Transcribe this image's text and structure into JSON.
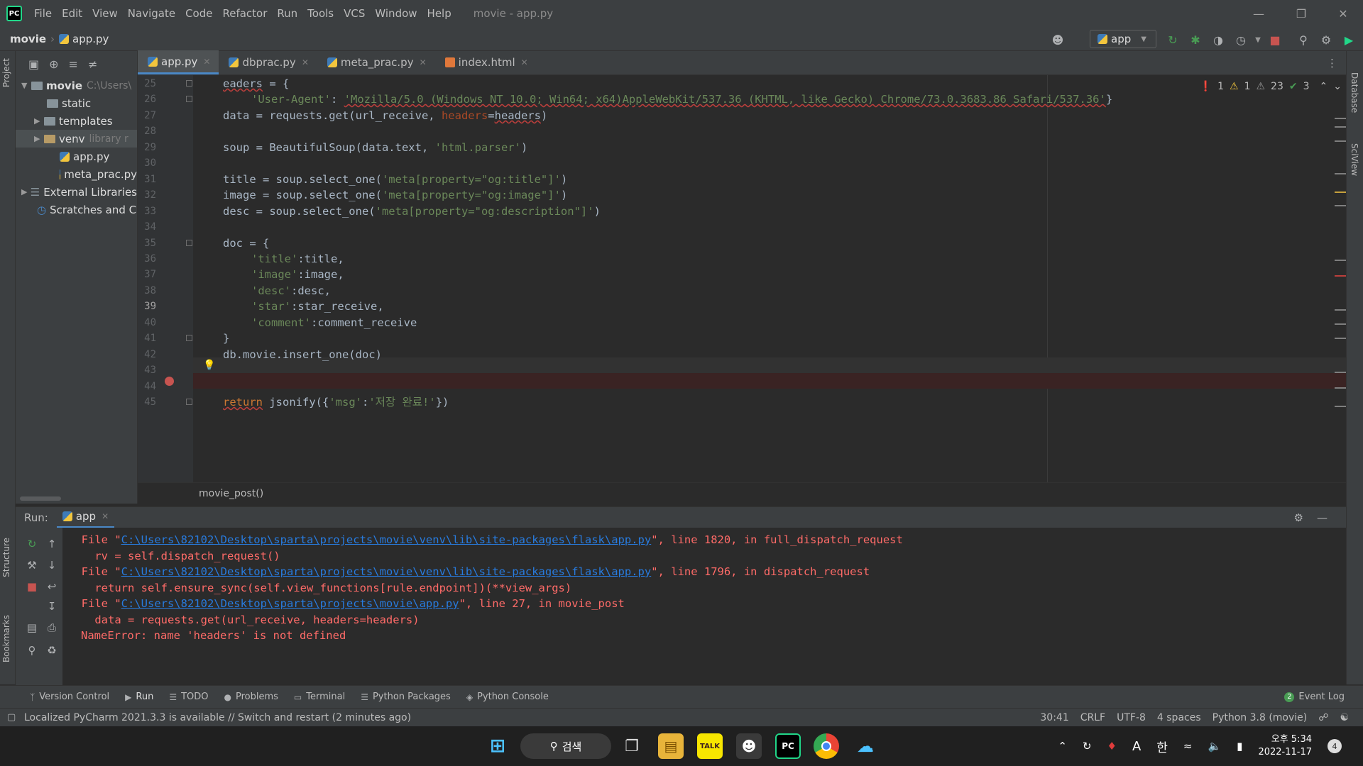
{
  "window": {
    "title": "movie - app.py",
    "menu": [
      "File",
      "Edit",
      "View",
      "Navigate",
      "Code",
      "Refactor",
      "Run",
      "Tools",
      "VCS",
      "Window",
      "Help"
    ],
    "logo_text": "PC"
  },
  "navbar": {
    "project": "movie",
    "file": "app.py",
    "run_config": "app"
  },
  "left_stripe": {
    "project_tab": "Project",
    "structure_tab": "Structure",
    "bookmarks_tab": "Bookmarks"
  },
  "right_stripe": {
    "database_tab": "Database",
    "sciview_tab": "SciView"
  },
  "project_tree": [
    {
      "label": "movie",
      "muted": "C:\\Users\\",
      "indent": 0,
      "type": "folder",
      "expanded": true
    },
    {
      "label": "static",
      "muted": "",
      "indent": 2,
      "type": "folder",
      "expanded": false
    },
    {
      "label": "templates",
      "muted": "",
      "indent": 1,
      "type": "folder",
      "expanded": false
    },
    {
      "label": "venv",
      "muted": "library r",
      "indent": 1,
      "type": "folder",
      "expanded": false
    },
    {
      "label": "app.py",
      "muted": "",
      "indent": 2,
      "type": "py"
    },
    {
      "label": "meta_prac.py",
      "muted": "",
      "indent": 2,
      "type": "py"
    },
    {
      "label": "External Libraries",
      "muted": "",
      "indent": 0,
      "type": "lib"
    },
    {
      "label": "Scratches and Co",
      "muted": "",
      "indent": 0,
      "type": "scratch"
    }
  ],
  "editor_tabs": [
    {
      "label": "app.py",
      "active": true,
      "icon": "py"
    },
    {
      "label": "dbprac.py",
      "active": false,
      "icon": "py"
    },
    {
      "label": "meta_prac.py",
      "active": false,
      "icon": "py"
    },
    {
      "label": "index.html",
      "active": false,
      "icon": "html"
    }
  ],
  "inspections": {
    "errors": "1",
    "warnings": "1",
    "weak_warnings": "23",
    "typos": "3"
  },
  "code": {
    "line_numbers": [
      "25",
      "26",
      "27",
      "28",
      "29",
      "30",
      "31",
      "32",
      "33",
      "34",
      "35",
      "36",
      "37",
      "38",
      "39",
      "40",
      "41",
      "42",
      "43",
      "44",
      "45"
    ],
    "current_line": "39",
    "breakpoint_line": "40",
    "l25_a": "eaders",
    "l25_b": " = {",
    "l26_key": "'User-Agent'",
    "l26_colon": ": ",
    "l26_val": "'Mozilla/5.0 (Windows NT 10.0; Win64; x64)AppleWebKit/537.36 (KHTML, like Gecko) Chrome/73.0.3683.86 Safari/537.36'",
    "l26_end": "}",
    "l27_a": "data = requests.get(url_receive, ",
    "l27_param": "headers",
    "l27_eq": "=",
    "l27_b": "headers",
    "l27_c": ")",
    "l29_a": "soup = BeautifulSoup(data.text, ",
    "l29_str": "'html.parser'",
    "l29_c": ")",
    "l31_a": "title = soup.select_one(",
    "l31_str": "'meta[property=\"og:title\"]'",
    "l31_c": ")",
    "l32_a": "image = soup.select_one(",
    "l32_str": "'meta[property=\"og:image\"]'",
    "l32_c": ")",
    "l33_a": "desc = soup.select_one(",
    "l33_str": "'meta[property=\"og:description\"]'",
    "l33_c": ")",
    "l35": "doc = {",
    "l36_str": "'title'",
    "l36_b": ":title,",
    "l37_str": "'image'",
    "l37_b": ":image,",
    "l38_str": "'desc'",
    "l38_b": ":desc,",
    "l39_str": "'star'",
    "l39_b": ":star_receive,",
    "l40_str": "'comment'",
    "l40_b": ":comment_receive",
    "l41": "}",
    "l42": "db.movie.insert_one(doc)",
    "l45_kw": "return",
    "l45_a": " jsonify({",
    "l45_str1": "'msg'",
    "l45_colon": ":",
    "l45_str2": "'저장 완료!'",
    "l45_c": "})"
  },
  "function_breadcrumb": "movie_post()",
  "run_panel": {
    "label": "Run:",
    "tab": "app",
    "lines": [
      {
        "pre": "  File \"",
        "link": "C:\\Users\\82102\\Desktop\\sparta\\projects\\movie\\venv\\lib\\site-packages\\flask\\app.py",
        "post": "\", line 1820, in full_dispatch_request"
      },
      {
        "pre": "    rv = self.dispatch_request()",
        "link": "",
        "post": ""
      },
      {
        "pre": "  File \"",
        "link": "C:\\Users\\82102\\Desktop\\sparta\\projects\\movie\\venv\\lib\\site-packages\\flask\\app.py",
        "post": "\", line 1796, in dispatch_request"
      },
      {
        "pre": "    return self.ensure_sync(self.view_functions[rule.endpoint])(**view_args)",
        "link": "",
        "post": ""
      },
      {
        "pre": "  File \"",
        "link": "C:\\Users\\82102\\Desktop\\sparta\\projects\\movie\\app.py",
        "post": "\", line 27, in movie_post"
      },
      {
        "pre": "    data = requests.get(url_receive, headers=headers)",
        "link": "",
        "post": ""
      },
      {
        "pre": "NameError: name 'headers' is not defined",
        "link": "",
        "post": ""
      }
    ]
  },
  "tool_tabs": [
    "Version Control",
    "Run",
    "TODO",
    "Problems",
    "Terminal",
    "Python Packages",
    "Python Console"
  ],
  "event_log": {
    "count": "2",
    "label": "Event Log"
  },
  "status": {
    "message": "Localized PyCharm 2021.3.3 is available // Switch and restart (2 minutes ago)",
    "position": "30:41",
    "line_sep": "CRLF",
    "encoding": "UTF-8",
    "indent": "4 spaces",
    "interpreter": "Python 3.8 (movie)"
  },
  "taskbar": {
    "search": "검색",
    "ime_a": "A",
    "ime_lang": "한",
    "time": "오후 5:34",
    "date": "2022-11-17",
    "notif_count": "4",
    "kakao_label": "TALK"
  },
  "colors": {
    "accent": "#4a88c7",
    "error": "#ff6b68",
    "string": "#6a8759",
    "keyword": "#cc7832"
  }
}
